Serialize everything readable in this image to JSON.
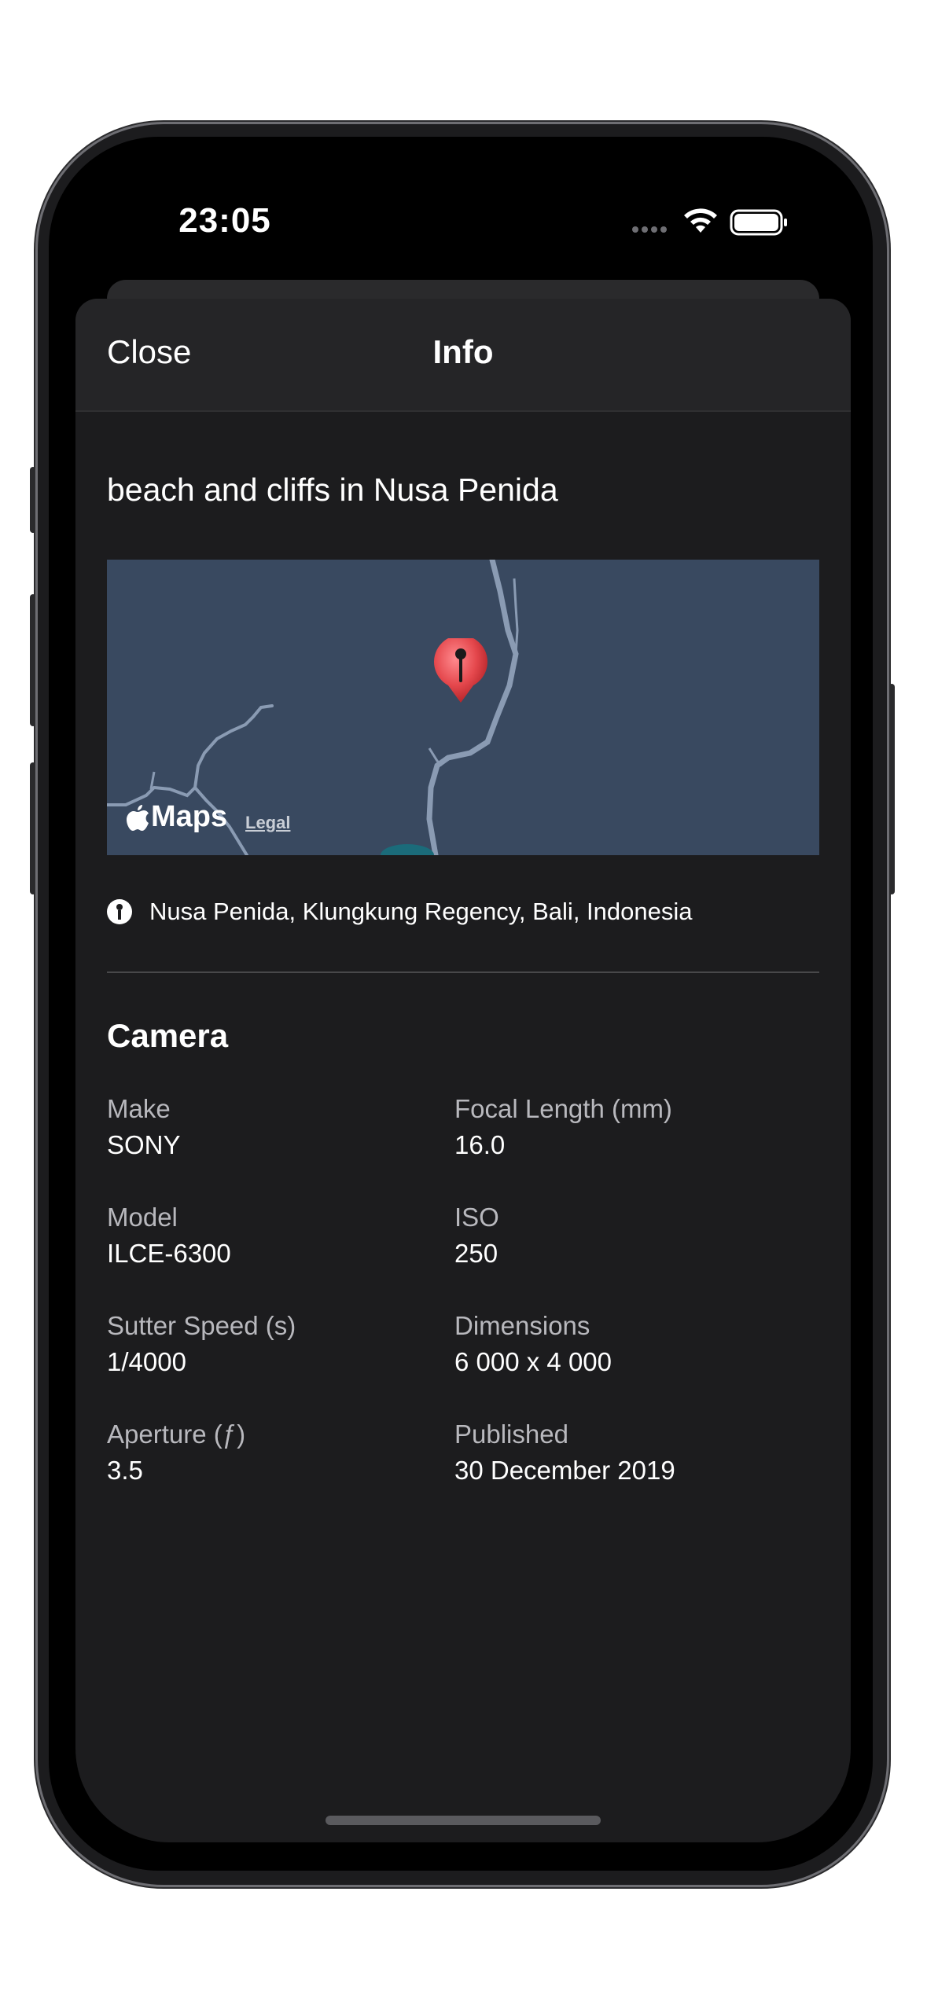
{
  "status_bar": {
    "time": "23:05",
    "icons": [
      "signal-dots-icon",
      "wifi-icon",
      "battery-icon"
    ]
  },
  "navbar": {
    "close_label": "Close",
    "title": "Info"
  },
  "photo": {
    "title": "beach and cliffs in Nusa Penida"
  },
  "map": {
    "logo_text": "Maps",
    "legal_label": "Legal",
    "pin_icon": "map-pin-icon"
  },
  "location": {
    "icon": "location-info-icon",
    "text": "Nusa Penida, Klungkung Regency, Bali, Indonesia"
  },
  "camera": {
    "section_title": "Camera",
    "fields": [
      {
        "label": "Make",
        "value": "SONY"
      },
      {
        "label": "Focal Length (mm)",
        "value": "16.0"
      },
      {
        "label": "Model",
        "value": "ILCE-6300"
      },
      {
        "label": "ISO",
        "value": "250"
      },
      {
        "label": "Sutter Speed (s)",
        "value": "1/4000"
      },
      {
        "label": "Dimensions",
        "value": "6 000 x 4 000"
      },
      {
        "label": "Aperture (ƒ)",
        "value": "3.5"
      },
      {
        "label": "Published",
        "value": "30 December 2019"
      }
    ]
  },
  "colors": {
    "sheet_background": "#1c1c1e",
    "navbar_background": "#252527",
    "map_background": "#394960",
    "pin_red": "#e5484d"
  }
}
